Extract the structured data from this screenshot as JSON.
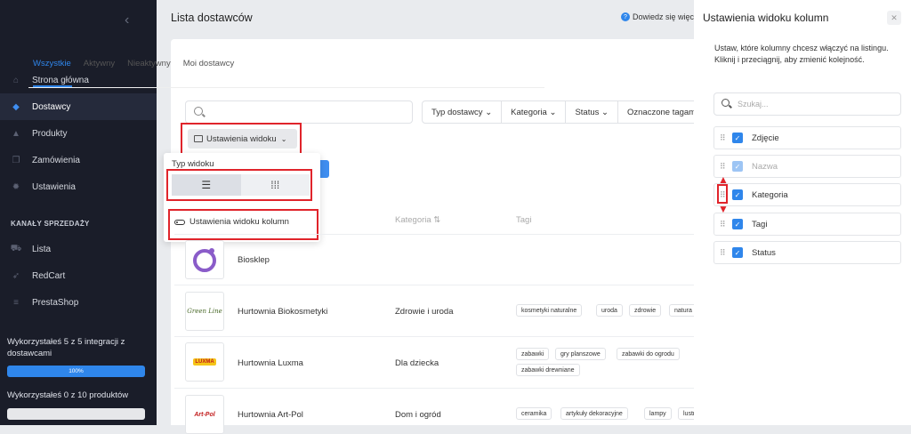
{
  "sidebar": {
    "nav": [
      {
        "label": "Strona główna",
        "icon": "home-icon"
      },
      {
        "label": "Dostawcy",
        "icon": "box-icon",
        "active": true
      },
      {
        "label": "Produkty",
        "icon": "product-icon"
      },
      {
        "label": "Zamówienia",
        "icon": "orders-icon"
      },
      {
        "label": "Ustawienia",
        "icon": "gear-icon"
      }
    ],
    "section_head": "KANAŁY SPRZEDAŻY",
    "channels": [
      {
        "label": "Lista",
        "icon": "cart-icon"
      },
      {
        "label": "RedCart",
        "icon": "redcart-icon"
      },
      {
        "label": "PrestaShop",
        "icon": "prestashop-icon"
      }
    ],
    "usage_integrations": "Wykorzystałeś 5 z 5 integracji z dostawcami",
    "usage_integrations_progress": 1.0,
    "usage_integrations_pct": "100%",
    "usage_products": "Wykorzystałeś 0 z 10 produktów",
    "usage_products_progress": 0.0
  },
  "main": {
    "title": "Lista dostawców",
    "help": "Dowiedz się więcej",
    "tabs": [
      "Wszystkie",
      "Aktywny",
      "Nieaktywny",
      "Moi dostawcy"
    ],
    "filters": [
      "Typ dostawcy",
      "Kategoria",
      "Status",
      "Oznaczone tagami"
    ],
    "view_settings_button": "Ustawienia widoku",
    "dropdown": {
      "view_type_label": "Typ widoku",
      "column_settings": "Ustawienia widoku kolumn"
    },
    "columns": {
      "category": "Kategoria",
      "tags": "Tagi"
    },
    "rows": [
      {
        "name": "Biosklep",
        "category": "",
        "tags": []
      },
      {
        "name": "Hurtownia Biokosmetyki",
        "category": "Zdrowie i uroda",
        "tags": [
          "kosmetyki naturalne",
          "uroda",
          "zdrowie",
          "natura"
        ],
        "logo": "Green Line"
      },
      {
        "name": "Hurtownia Luxma",
        "category": "Dla dziecka",
        "tags": [
          "zabawki",
          "gry planszowe",
          "zabawki do ogrodu",
          "zabawki drewniane"
        ],
        "logo": "LUXMA"
      },
      {
        "name": "Hurtownia Art-Pol",
        "category": "Dom i ogród",
        "tags": [
          "ceramika",
          "artykuły dekoracyjne",
          "lampy",
          "lustra"
        ],
        "logo": "Art-Pol"
      }
    ]
  },
  "panel": {
    "title": "Ustawienia widoku kolumn",
    "desc_line1": "Ustaw, które kolumny chcesz włączyć na listingu.",
    "desc_line2": "Kliknij i przeciągnij, aby zmienić kolejność.",
    "search_placeholder": "Szukaj...",
    "items": [
      {
        "label": "Zdjęcie",
        "checked": true,
        "disabled": false
      },
      {
        "label": "Nazwa",
        "checked": true,
        "disabled": true
      },
      {
        "label": "Kategoria",
        "checked": true,
        "disabled": false
      },
      {
        "label": "Tagi",
        "checked": true,
        "disabled": false
      },
      {
        "label": "Status",
        "checked": true,
        "disabled": false
      }
    ]
  },
  "colors": {
    "accent": "#2f86eb",
    "sidebar": "#1a1d29",
    "highlight": "#e0242b"
  }
}
